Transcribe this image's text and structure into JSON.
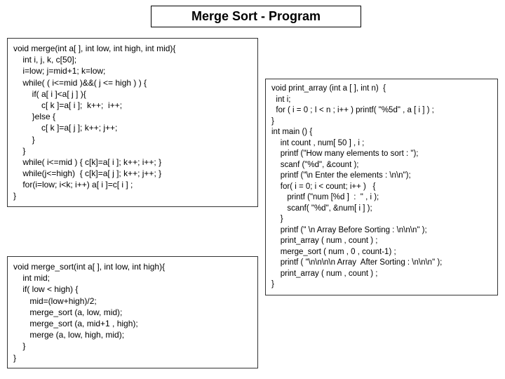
{
  "title": "Merge Sort -  Program",
  "code": {
    "merge": "void merge(int a[ ], int low, int high, int mid){\n    int i, j, k, c[50];\n    i=low; j=mid+1; k=low;\n    while( ( i<=mid )&&( j <= high ) ) {\n        if( a[ i ]<a[ j ] ){\n            c[ k ]=a[ i ];  k++;  i++;\n        }else {\n            c[ k ]=a[ j ]; k++; j++;\n        }\n    }\n    while( i<=mid ) { c[k]=a[ i ]; k++; i++; }\n    while(j<=high)  { c[k]=a[ j ]; k++; j++; }\n    for(i=low; i<k; i++) a[ i ]=c[ i ] ;\n}",
    "merge_sort": "void merge_sort(int a[ ], int low, int high){\n    int mid;\n    if( low < high) {\n       mid=(low+high)/2;\n       merge_sort (a, low, mid);\n       merge_sort (a, mid+1 , high);\n       merge (a, low, high, mid);\n    }\n}",
    "main": "void print_array (int a [ ], int n)  {\n  int i;\n  for ( i = 0 ; I < n ; i++ ) printf( \"%5d\" , a [ i ] ) ;\n}\nint main () {\n    int count , num[ 50 ] , i ;\n    printf (\"How many elements to sort : \");\n    scanf (\"%d\", &count );\n    printf (\"\\n Enter the elements : \\n\\n\");\n    for( i = 0; i < count; i++ )   {\n       printf (\"num [%d ]  :  \" , i );\n       scanf( \"%d\", &num[ i ] );\n    }\n    printf (\" \\n Array Before Sorting : \\n\\n\\n\" );\n    print_array ( num , count ) ;\n    merge_sort ( num , 0 , count-1) ;\n    printf ( \"\\n\\n\\n\\n Array  After Sorting : \\n\\n\\n\" );\n    print_array ( num , count ) ;\n}"
  }
}
